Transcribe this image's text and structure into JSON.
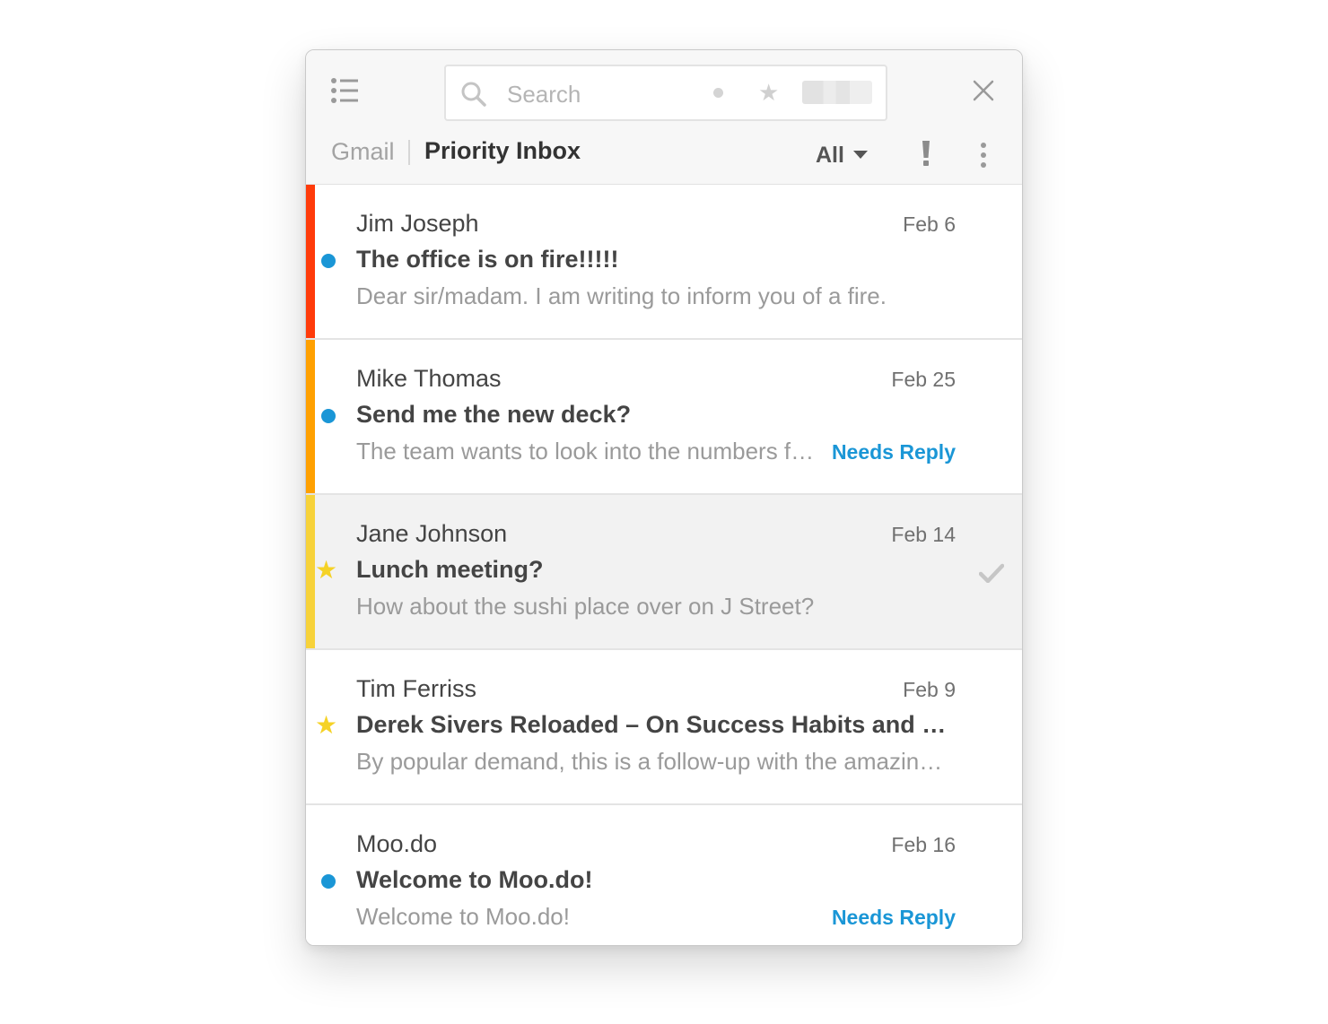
{
  "search": {
    "placeholder": "Search"
  },
  "breadcrumb": {
    "account": "Gmail",
    "current": "Priority Inbox"
  },
  "filter": {
    "selected": "All"
  },
  "icons": {
    "menu": "list-icon",
    "search": "search-icon",
    "unread_filter": "dot-icon",
    "starred_filter": "star-icon",
    "close": "close-icon",
    "priority": "exclamation-icon",
    "more": "more-vertical-icon",
    "done": "check-icon"
  },
  "colors": {
    "unread_dot": "#1a96d6",
    "star": "#f5d226",
    "needs_reply": "#1a96d6",
    "priority_high": "#ff3b0a",
    "priority_medium": "#ffa000",
    "priority_low": "#f7d23a"
  },
  "emails": [
    {
      "sender": "Jim Joseph",
      "date": "Feb 6",
      "subject": "The office is on fire!!!!!",
      "snippet": "Dear sir/madam. I am writing to inform you of a fire.",
      "indicator": "unread-dot",
      "priority_color": "#ff3b0a",
      "tag": ""
    },
    {
      "sender": "Mike Thomas",
      "date": "Feb 25",
      "subject": "Send me the new deck?",
      "snippet": "The team wants to look into the numbers for the new deck",
      "indicator": "unread-dot",
      "priority_color": "#ffa000",
      "tag": "Needs Reply"
    },
    {
      "sender": "Jane Johnson",
      "date": "Feb 14",
      "subject": "Lunch meeting?",
      "snippet": "How about the sushi place over on J Street?",
      "indicator": "star",
      "priority_color": "#f7d23a",
      "tag": ""
    },
    {
      "sender": "Tim Ferriss",
      "date": "Feb 9",
      "subject": "Derek Sivers Reloaded – On Success Habits and Billionaires",
      "snippet": "By popular demand, this is a follow-up with the amazing Derek Sivers",
      "indicator": "star",
      "priority_color": "",
      "tag": ""
    },
    {
      "sender": "Moo.do",
      "date": "Feb 16",
      "subject": "Welcome to Moo.do!",
      "snippet": "Welcome to Moo.do!",
      "indicator": "unread-dot",
      "priority_color": "",
      "tag": "Needs Reply"
    }
  ]
}
